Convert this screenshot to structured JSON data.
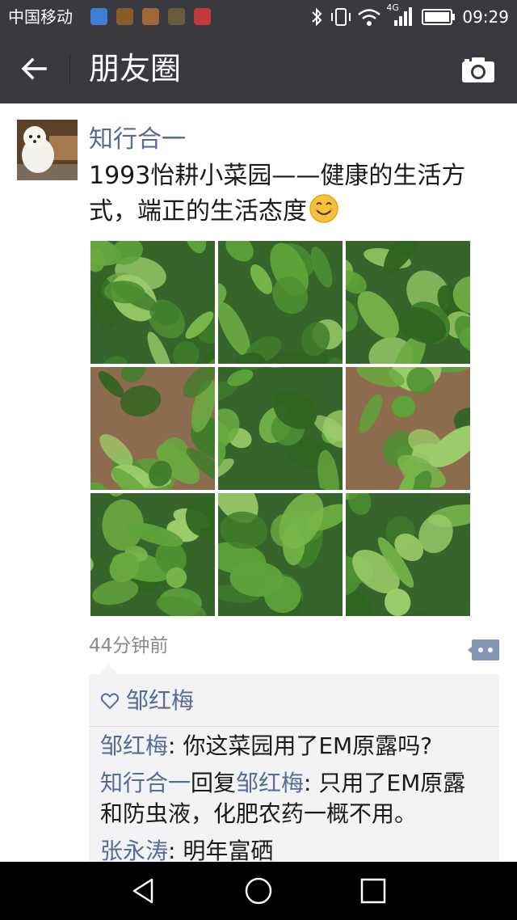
{
  "status_bar": {
    "carrier": "中国移动",
    "network": "4G",
    "time": "09:29",
    "notification_icons": [
      "browser-app-icon",
      "app-icon",
      "app-icon",
      "app-icon",
      "app-icon"
    ]
  },
  "header": {
    "title": "朋友圈",
    "back_icon": "arrow-left-icon",
    "camera_icon": "camera-icon"
  },
  "post": {
    "author": "知行合一",
    "text": "1993怡耕小菜园——健康的生活方式，端正的生活态度",
    "emoji": "smiling-face-emoji",
    "photos": [
      {
        "name": "lettuce-photo-1"
      },
      {
        "name": "lettuce-photo-2"
      },
      {
        "name": "lettuce-photo-3"
      },
      {
        "name": "lettuce-photo-4"
      },
      {
        "name": "lettuce-photo-5"
      },
      {
        "name": "lettuce-photo-6"
      },
      {
        "name": "lettuce-photo-7"
      },
      {
        "name": "lettuce-photo-8"
      },
      {
        "name": "lettuce-photo-9"
      }
    ],
    "time": "44分钟前"
  },
  "likes": {
    "names": "邹红梅"
  },
  "comments": [
    {
      "author": "邹红梅",
      "sep": ": ",
      "text": "你这菜园用了EM原露吗?"
    },
    {
      "author": "知行合一",
      "reply_word": "回复",
      "reply_to": "邹红梅",
      "sep": ": ",
      "text": "只用了EM原露和防虫液，化肥农药一概不用。"
    },
    {
      "author": "张永涛",
      "sep": ": ",
      "text": "明年富硒"
    }
  ],
  "colors": {
    "bar": "#393a3f",
    "link": "#576b95",
    "comment_bg": "#f3f3f5"
  }
}
